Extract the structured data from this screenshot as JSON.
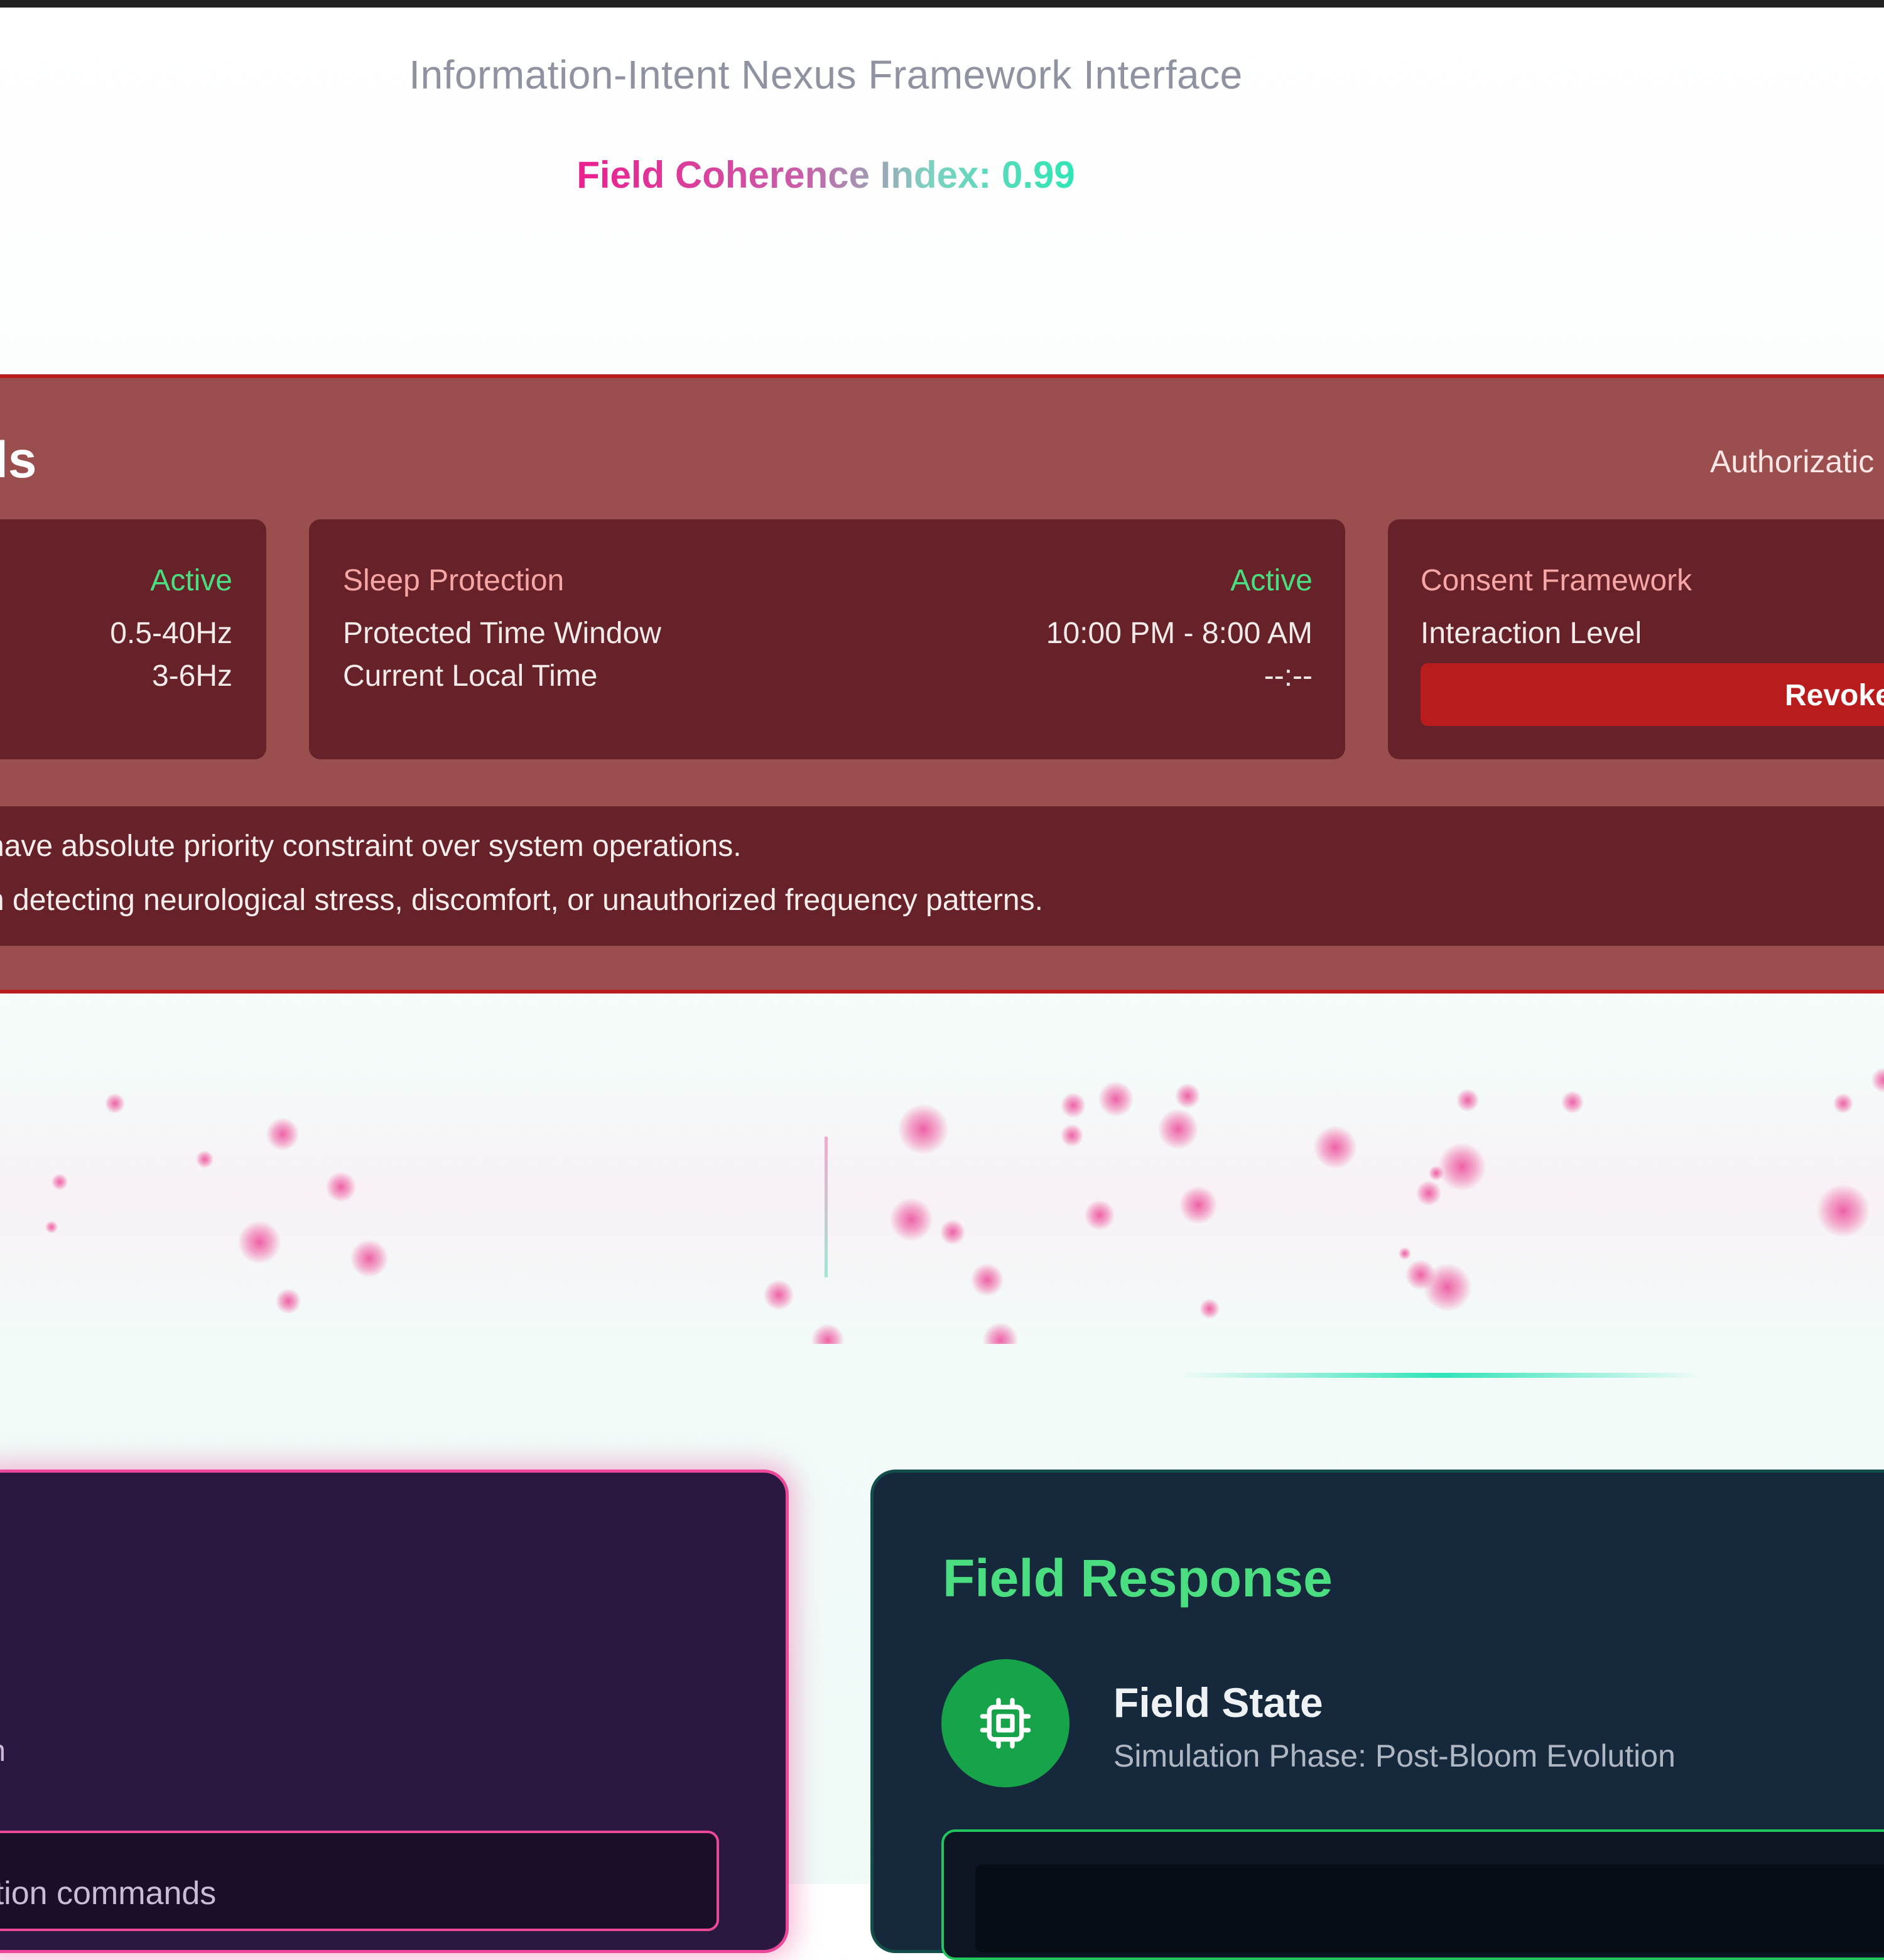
{
  "header": {
    "subtitle": "Information-Intent Nexus Framework Interface",
    "coherence": "Field Coherence Index: 0.99"
  },
  "safety": {
    "title_fragment": "ols",
    "authorization_fragment": "Authorizatic",
    "cards": [
      {
        "status": "Active",
        "rows": [
          {
            "value": "0.5-40Hz"
          },
          {
            "value": "3-6Hz"
          }
        ]
      },
      {
        "title": "Sleep Protection",
        "status": "Active",
        "rows": [
          {
            "label": "Protected Time Window",
            "value": "10:00 PM - 8:00 AM"
          },
          {
            "label": "Current Local Time",
            "value": "--:--"
          }
        ]
      },
      {
        "title": "Consent Framework",
        "rows": [
          {
            "label": "Interaction Level"
          }
        ],
        "button": "Revoke"
      }
    ],
    "notice_lines": [
      "have absolute priority constraint over system operations.",
      "n detecting neurological stress, discomfort, or unauthorized frequency patterns."
    ]
  },
  "intent_panel": {
    "subtitle_fragment": "ution",
    "input_placeholder": "mulation commands"
  },
  "response_panel": {
    "title": "Field Response",
    "state_title": "Field State",
    "state_subtitle": "Simulation Phase: Post-Bloom Evolution",
    "icon": "cpu-chip-icon"
  },
  "colors": {
    "accent_pink": "#ec4899",
    "accent_green": "#4ade80",
    "danger_red": "#b91c1c",
    "card_bg": "#662228"
  }
}
